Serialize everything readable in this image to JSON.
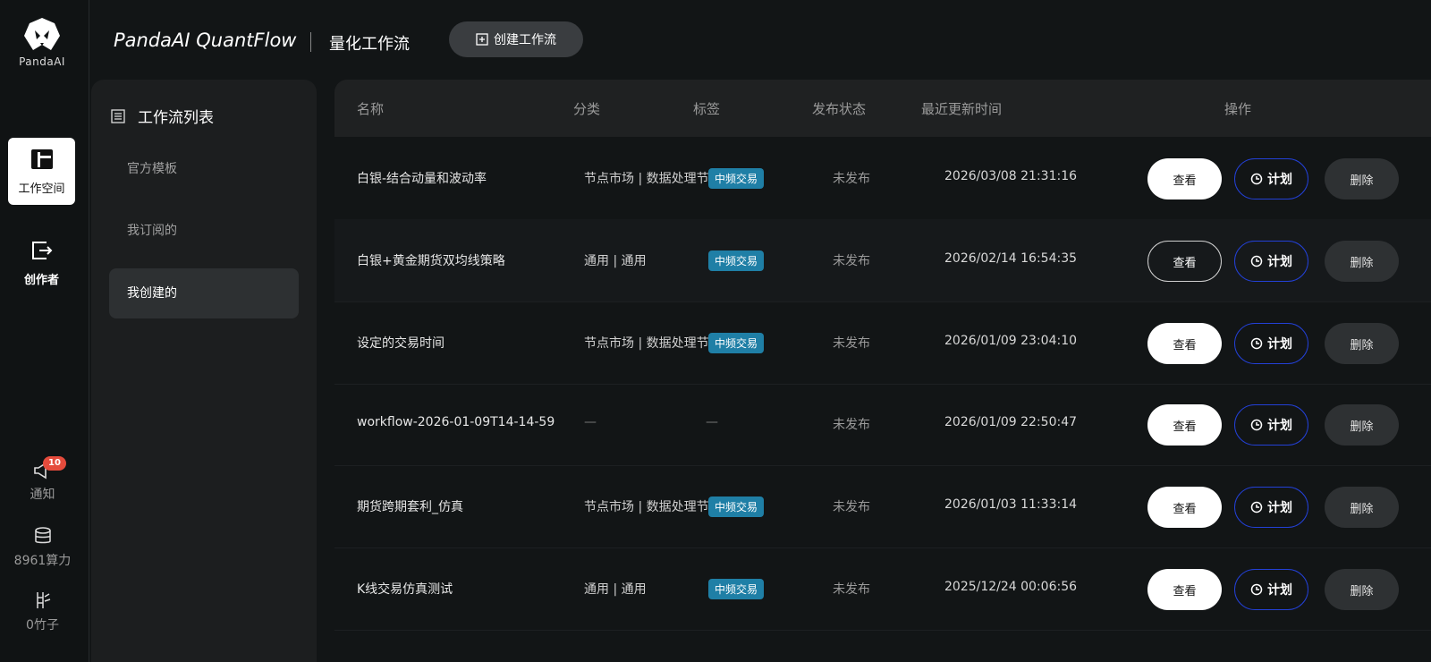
{
  "brand": {
    "logo_text": "PandaAI",
    "app_name": "PandaAI QuantFlow",
    "page_title": "量化工作流",
    "create_button": "创建工作流"
  },
  "rail": {
    "workspace": "工作空间",
    "creator": "创作者",
    "notify": {
      "label": "通知",
      "badge": "10"
    },
    "compute": "8961算力",
    "bamboo": "0竹子"
  },
  "subnav": {
    "title": "工作流列表",
    "items": [
      "官方模板",
      "我订阅的",
      "我创建的"
    ],
    "active": "我创建的"
  },
  "table": {
    "columns": [
      "名称",
      "分类",
      "标签",
      "发布状态",
      "最近更新时间",
      "操作"
    ],
    "actions": {
      "view": "查看",
      "plan": "计划",
      "delete": "删除"
    },
    "rows": [
      {
        "name": "白银-结合动量和波动率",
        "category": "节点市场 | 数据处理节点",
        "tag": "中频交易",
        "status": "未发布",
        "updated": "2026/03/08 21:31:16"
      },
      {
        "name": "白银+黄金期货双均线策略",
        "category": "通用 | 通用",
        "tag": "中频交易",
        "status": "未发布",
        "updated": "2026/02/14 16:54:35"
      },
      {
        "name": "设定的交易时间",
        "category": "节点市场 | 数据处理节点",
        "tag": "中频交易",
        "status": "未发布",
        "updated": "2026/01/09 23:04:10"
      },
      {
        "name": "workflow-2026-01-09T14-14-59",
        "category": "—",
        "tag": "—",
        "status": "未发布",
        "updated": "2026/01/09 22:50:47"
      },
      {
        "name": "期货跨期套利_仿真",
        "category": "节点市场 | 数据处理节点",
        "tag": "中频交易",
        "status": "未发布",
        "updated": "2026/01/03 11:33:14"
      },
      {
        "name": "K线交易仿真测试",
        "category": "通用 | 通用",
        "tag": "中频交易",
        "status": "未发布",
        "updated": "2025/12/24 00:06:56"
      }
    ]
  },
  "colors": {
    "tag_bg": "#1f7fa6",
    "plan_border": "#2340d6",
    "badge": "#e54b3c"
  }
}
